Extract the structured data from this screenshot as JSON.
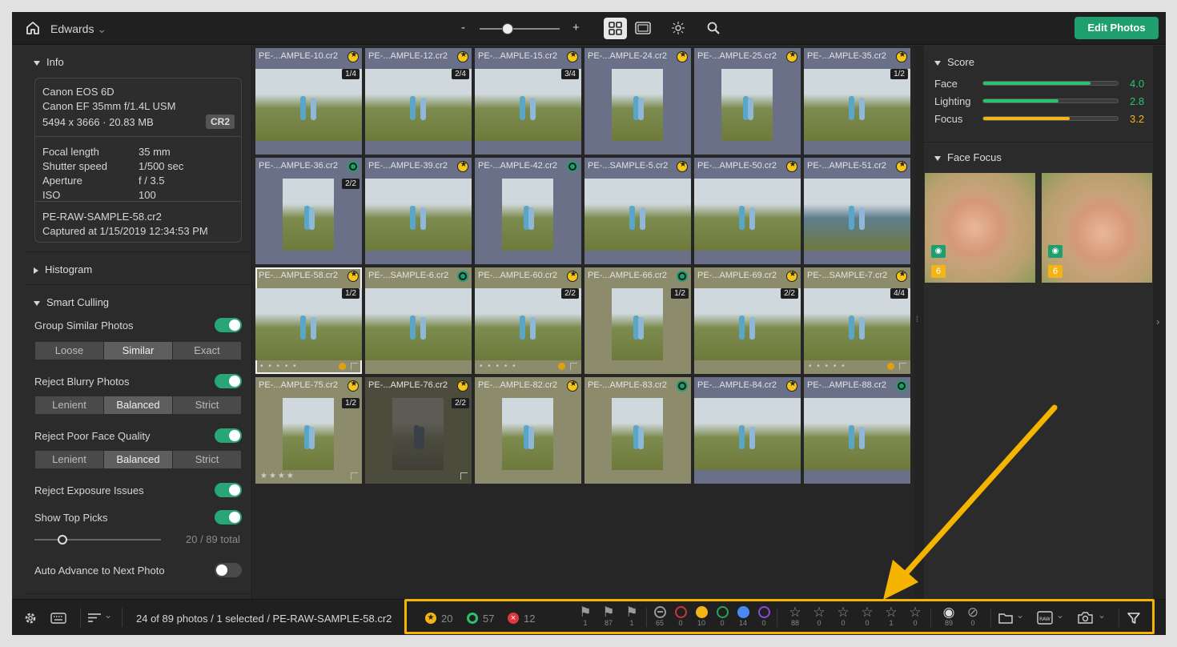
{
  "topbar": {
    "user": "Edwards",
    "zoom_minus": "-",
    "zoom_plus": "+",
    "zoom_level": 0.35,
    "edit_button": "Edit Photos"
  },
  "info": {
    "title": "Info",
    "camera": "Canon EOS 6D",
    "lens": "Canon EF 35mm f/1.4L USM",
    "dims": "5494 x 3666 · 20.83 MB",
    "format": "CR2",
    "exif": [
      {
        "label": "Focal length",
        "value": "35 mm"
      },
      {
        "label": "Shutter speed",
        "value": "1/500 sec"
      },
      {
        "label": "Aperture",
        "value": "f / 3.5"
      },
      {
        "label": "ISO",
        "value": "100"
      }
    ],
    "filename": "PE-RAW-SAMPLE-58.cr2",
    "captured": "Captured at 1/15/2019 12:34:53 PM"
  },
  "histogram": {
    "title": "Histogram"
  },
  "culling": {
    "title": "Smart Culling",
    "group_label": "Group Similar Photos",
    "group_options": [
      "Loose",
      "Similar",
      "Exact"
    ],
    "blurry_label": "Reject Blurry Photos",
    "blurry_options": [
      "Lenient",
      "Balanced",
      "Strict"
    ],
    "face_label": "Reject Poor Face Quality",
    "face_options": [
      "Lenient",
      "Balanced",
      "Strict"
    ],
    "exposure_label": "Reject Exposure Issues",
    "top_label": "Show Top Picks",
    "top_count": "20",
    "top_total": " / 89 total",
    "top_slider": 0.22,
    "advance_label": "Auto Advance to Next Photo"
  },
  "grid": [
    {
      "name": "PE-...AMPLE-10.cr2",
      "badge": "yellow",
      "stack": "1/4",
      "bg": "#6a7088"
    },
    {
      "name": "PE-...AMPLE-12.cr2",
      "badge": "yellow",
      "stack": "2/4",
      "bg": "#6a7088"
    },
    {
      "name": "PE-...AMPLE-15.cr2",
      "badge": "yellow",
      "stack": "3/4",
      "bg": "#6a7088"
    },
    {
      "name": "PE-...AMPLE-24.cr2",
      "badge": "yellow",
      "stack": "",
      "bg": "#6a7088"
    },
    {
      "name": "PE-...AMPLE-25.cr2",
      "badge": "yellow",
      "stack": "",
      "bg": "#6a7088"
    },
    {
      "name": "PE-...AMPLE-35.cr2",
      "badge": "yellow",
      "stack": "1/2",
      "bg": "#6a7088"
    },
    {
      "name": "PE-...AMPLE-36.cr2",
      "badge": "green",
      "stack": "2/2",
      "bg": "#6a7088"
    },
    {
      "name": "PE-...AMPLE-39.cr2",
      "badge": "yellow",
      "stack": "",
      "bg": "#6a7088"
    },
    {
      "name": "PE-...AMPLE-42.cr2",
      "badge": "green",
      "stack": "",
      "bg": "#6a7088"
    },
    {
      "name": "PE-...SAMPLE-5.cr2",
      "badge": "yellow",
      "stack": "",
      "bg": "#6a7088"
    },
    {
      "name": "PE-...AMPLE-50.cr2",
      "badge": "yellow",
      "stack": "",
      "bg": "#6a7088"
    },
    {
      "name": "PE-...AMPLE-51.cr2",
      "badge": "yellow",
      "stack": "",
      "bg": "#6a7088"
    },
    {
      "name": "PE-...AMPLE-58.cr2",
      "badge": "yellow",
      "stack": "1/2",
      "bg": "#8c8c6c"
    },
    {
      "name": "PE-...SAMPLE-6.cr2",
      "badge": "green",
      "stack": "",
      "bg": "#8c8c6c"
    },
    {
      "name": "PE-...AMPLE-60.cr2",
      "badge": "yellow",
      "stack": "2/2",
      "bg": "#8c8c6c"
    },
    {
      "name": "PE-...AMPLE-66.cr2",
      "badge": "green",
      "stack": "1/2",
      "bg": "#8c8c6c"
    },
    {
      "name": "PE-...AMPLE-69.cr2",
      "badge": "yellow",
      "stack": "2/2",
      "bg": "#8c8c6c"
    },
    {
      "name": "PE-...SAMPLE-7.cr2",
      "badge": "yellow",
      "stack": "4/4",
      "bg": "#8c8c6c"
    },
    {
      "name": "PE-...AMPLE-75.cr2",
      "badge": "yellow",
      "stack": "1/2",
      "bg": "#8c8c6c"
    },
    {
      "name": "PE-...AMPLE-76.cr2",
      "badge": "yellow",
      "stack": "2/2",
      "bg": "#4c4c3c"
    },
    {
      "name": "PE-...AMPLE-82.cr2",
      "badge": "yellow",
      "stack": "",
      "bg": "#8c8c6c"
    },
    {
      "name": "PE-...AMPLE-83.cr2",
      "badge": "green",
      "stack": "",
      "bg": "#8c8c6c"
    },
    {
      "name": "PE-...AMPLE-84.cr2",
      "badge": "yellow",
      "stack": "",
      "bg": "#6a7088"
    },
    {
      "name": "PE-...AMPLE-88.cr2",
      "badge": "green",
      "stack": "",
      "bg": "#6a7088"
    }
  ],
  "score": {
    "title": "Score",
    "rows": [
      {
        "label": "Face",
        "value": "4.0",
        "level": 0.8,
        "color": "#27c36e"
      },
      {
        "label": "Lighting",
        "value": "2.8",
        "level": 0.56,
        "color": "#27c36e"
      },
      {
        "label": "Focus",
        "value": "3.2",
        "level": 0.64,
        "color": "#f3b515"
      }
    ]
  },
  "faceFocus": {
    "title": "Face Focus",
    "faces": [
      {
        "count": "6"
      },
      {
        "count": "6"
      }
    ]
  },
  "status": {
    "text": "24 of 89 photos / 1 selected / PE-RAW-SAMPLE-58.cr2"
  },
  "counts": {
    "picks": "20",
    "accepted": "57",
    "rejected": "12",
    "flags": [
      "1",
      "87",
      "1"
    ],
    "colors": [
      "65",
      "0",
      "10",
      "0",
      "14",
      "0"
    ],
    "stars": [
      "88",
      "0",
      "0",
      "0",
      "1",
      "0"
    ],
    "visible": "89",
    "hidden": "0"
  }
}
